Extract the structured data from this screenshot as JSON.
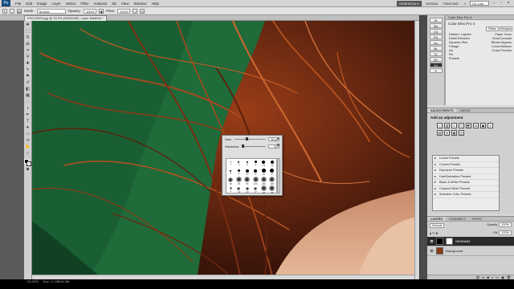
{
  "app": {
    "logo": "Ps",
    "menus": [
      "File",
      "Edit",
      "Image",
      "Layer",
      "Select",
      "Filter",
      "Analysis",
      "3D",
      "View",
      "Window",
      "Help"
    ],
    "workspaces": [
      "ESSENTIALS",
      "DESIGN",
      "PAINTING"
    ],
    "search_placeholder": "CS Live"
  },
  "options_bar": {
    "mode_label": "Mode:",
    "mode_value": "Normal",
    "opacity_label": "Opacity:",
    "opacity_value": "100%",
    "flow_label": "Flow:",
    "flow_value": "100%"
  },
  "document": {
    "tab_label": "DSC03329.jpg @ 33.3% (SKIN3463, Layer Mask/8) *"
  },
  "status": {
    "zoom": "33.33%",
    "doc_info": "Doc: 17.2M/18.3M"
  },
  "brush_picker": {
    "size_label": "Size:",
    "size_value": "50 px",
    "hardness_label": "Hardness:",
    "hardness_value": "0%",
    "size_fraction": 0.35,
    "hardness_fraction": 0.0,
    "presets": [
      "1",
      "3",
      "5",
      "9",
      "13",
      "19",
      "5",
      "9",
      "13",
      "17",
      "21",
      "27",
      "35",
      "45",
      "65",
      "100",
      "200",
      "300",
      "9",
      "13",
      "19",
      "17",
      "45",
      "65"
    ]
  },
  "panels": {
    "mini_tools": [
      "Hi",
      "Sw",
      "Ch",
      "Pa",
      "Ac",
      "Br",
      "Cl",
      "3D",
      "Co",
      "Ti"
    ],
    "color_efex": {
      "tab": "Color Efex Pro 4",
      "title": "Color Efex Pro 4",
      "buttons": [
        "Filters",
        "Recipes"
      ],
      "rows": [
        [
          "Darken / Lighten",
          "Paper Toner"
        ],
        [
          "Detail Extractor",
          "Tonal Contrast"
        ],
        [
          "Dynamic Skin",
          "Bleach Bypass"
        ],
        [
          "Foliage",
          "Cross Balance"
        ],
        [
          "Ink",
          "Cross Process"
        ],
        [
          "Fill",
          ""
        ],
        [
          "Presets",
          ""
        ]
      ]
    },
    "adjustments": {
      "tabs": [
        "ADJUSTMENTS",
        "MASKS"
      ],
      "heading": "Add an adjustment",
      "icons": [
        "☼",
        "▥",
        "◐",
        "▽",
        "◩",
        "⚖",
        "▣",
        "◑",
        "▤",
        "◎",
        "▦",
        "◫"
      ],
      "presets": [
        "Levels Presets",
        "Curves Presets",
        "Exposure Presets",
        "Hue/Saturation Presets",
        "Black & White Presets",
        "Channel Mixer Presets",
        "Selective Color Presets"
      ]
    },
    "layers": {
      "tabs": [
        "LAYERS",
        "CHANNELS",
        "PATHS"
      ],
      "blend_mode": "Normal",
      "opacity_label": "Opacity:",
      "opacity_value": "100%",
      "fill_label": "Fill:",
      "fill_value": "100%",
      "items": [
        {
          "name": "SKIN3463",
          "selected": true
        },
        {
          "name": "Background",
          "selected": false
        }
      ]
    }
  },
  "colors": {
    "mask_overlay": "#1f6b3a",
    "hair": "#7a2e12"
  }
}
